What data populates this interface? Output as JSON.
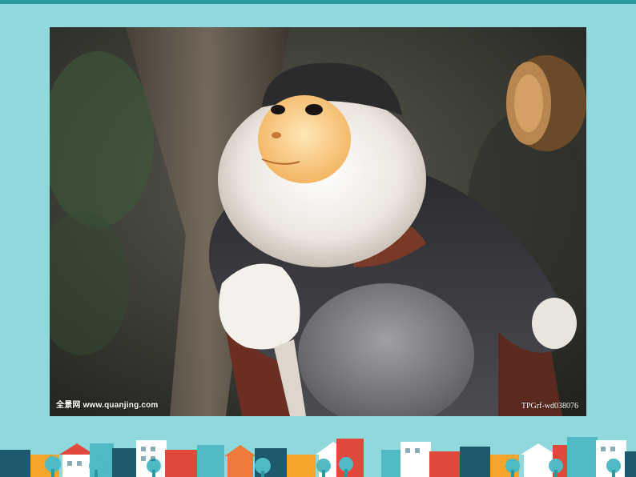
{
  "slide": {
    "background_color": "#8fd8dc",
    "accent_bar_color": "#2a9aa0"
  },
  "photo": {
    "subject": "monkey-photo",
    "watermark_left": "全景网  www.quanjing.com",
    "watermark_right": "TPGrf-wd038076"
  },
  "decoration": {
    "name": "town-skyline-border",
    "colors": [
      "#1e5a6e",
      "#f4a52a",
      "#e0493c",
      "#4fb9c4",
      "#ffffff",
      "#f07a3a"
    ]
  }
}
